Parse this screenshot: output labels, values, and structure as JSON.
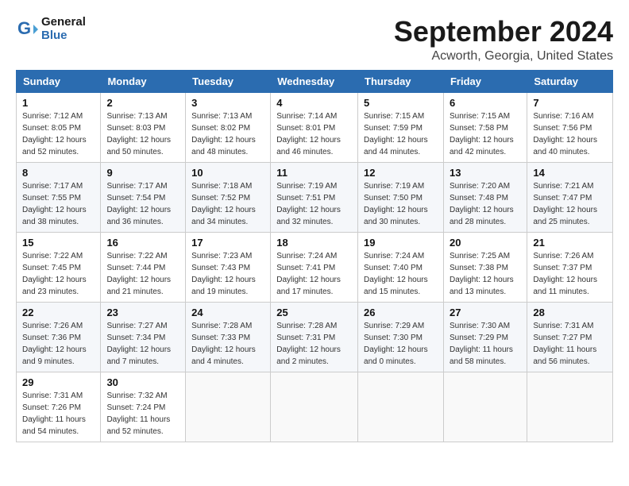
{
  "header": {
    "logo_line1": "General",
    "logo_line2": "Blue",
    "month": "September 2024",
    "location": "Acworth, Georgia, United States"
  },
  "days_of_week": [
    "Sunday",
    "Monday",
    "Tuesday",
    "Wednesday",
    "Thursday",
    "Friday",
    "Saturday"
  ],
  "weeks": [
    [
      {
        "day": "1",
        "info": "Sunrise: 7:12 AM\nSunset: 8:05 PM\nDaylight: 12 hours\nand 52 minutes."
      },
      {
        "day": "2",
        "info": "Sunrise: 7:13 AM\nSunset: 8:03 PM\nDaylight: 12 hours\nand 50 minutes."
      },
      {
        "day": "3",
        "info": "Sunrise: 7:13 AM\nSunset: 8:02 PM\nDaylight: 12 hours\nand 48 minutes."
      },
      {
        "day": "4",
        "info": "Sunrise: 7:14 AM\nSunset: 8:01 PM\nDaylight: 12 hours\nand 46 minutes."
      },
      {
        "day": "5",
        "info": "Sunrise: 7:15 AM\nSunset: 7:59 PM\nDaylight: 12 hours\nand 44 minutes."
      },
      {
        "day": "6",
        "info": "Sunrise: 7:15 AM\nSunset: 7:58 PM\nDaylight: 12 hours\nand 42 minutes."
      },
      {
        "day": "7",
        "info": "Sunrise: 7:16 AM\nSunset: 7:56 PM\nDaylight: 12 hours\nand 40 minutes."
      }
    ],
    [
      {
        "day": "8",
        "info": "Sunrise: 7:17 AM\nSunset: 7:55 PM\nDaylight: 12 hours\nand 38 minutes."
      },
      {
        "day": "9",
        "info": "Sunrise: 7:17 AM\nSunset: 7:54 PM\nDaylight: 12 hours\nand 36 minutes."
      },
      {
        "day": "10",
        "info": "Sunrise: 7:18 AM\nSunset: 7:52 PM\nDaylight: 12 hours\nand 34 minutes."
      },
      {
        "day": "11",
        "info": "Sunrise: 7:19 AM\nSunset: 7:51 PM\nDaylight: 12 hours\nand 32 minutes."
      },
      {
        "day": "12",
        "info": "Sunrise: 7:19 AM\nSunset: 7:50 PM\nDaylight: 12 hours\nand 30 minutes."
      },
      {
        "day": "13",
        "info": "Sunrise: 7:20 AM\nSunset: 7:48 PM\nDaylight: 12 hours\nand 28 minutes."
      },
      {
        "day": "14",
        "info": "Sunrise: 7:21 AM\nSunset: 7:47 PM\nDaylight: 12 hours\nand 25 minutes."
      }
    ],
    [
      {
        "day": "15",
        "info": "Sunrise: 7:22 AM\nSunset: 7:45 PM\nDaylight: 12 hours\nand 23 minutes."
      },
      {
        "day": "16",
        "info": "Sunrise: 7:22 AM\nSunset: 7:44 PM\nDaylight: 12 hours\nand 21 minutes."
      },
      {
        "day": "17",
        "info": "Sunrise: 7:23 AM\nSunset: 7:43 PM\nDaylight: 12 hours\nand 19 minutes."
      },
      {
        "day": "18",
        "info": "Sunrise: 7:24 AM\nSunset: 7:41 PM\nDaylight: 12 hours\nand 17 minutes."
      },
      {
        "day": "19",
        "info": "Sunrise: 7:24 AM\nSunset: 7:40 PM\nDaylight: 12 hours\nand 15 minutes."
      },
      {
        "day": "20",
        "info": "Sunrise: 7:25 AM\nSunset: 7:38 PM\nDaylight: 12 hours\nand 13 minutes."
      },
      {
        "day": "21",
        "info": "Sunrise: 7:26 AM\nSunset: 7:37 PM\nDaylight: 12 hours\nand 11 minutes."
      }
    ],
    [
      {
        "day": "22",
        "info": "Sunrise: 7:26 AM\nSunset: 7:36 PM\nDaylight: 12 hours\nand 9 minutes."
      },
      {
        "day": "23",
        "info": "Sunrise: 7:27 AM\nSunset: 7:34 PM\nDaylight: 12 hours\nand 7 minutes."
      },
      {
        "day": "24",
        "info": "Sunrise: 7:28 AM\nSunset: 7:33 PM\nDaylight: 12 hours\nand 4 minutes."
      },
      {
        "day": "25",
        "info": "Sunrise: 7:28 AM\nSunset: 7:31 PM\nDaylight: 12 hours\nand 2 minutes."
      },
      {
        "day": "26",
        "info": "Sunrise: 7:29 AM\nSunset: 7:30 PM\nDaylight: 12 hours\nand 0 minutes."
      },
      {
        "day": "27",
        "info": "Sunrise: 7:30 AM\nSunset: 7:29 PM\nDaylight: 11 hours\nand 58 minutes."
      },
      {
        "day": "28",
        "info": "Sunrise: 7:31 AM\nSunset: 7:27 PM\nDaylight: 11 hours\nand 56 minutes."
      }
    ],
    [
      {
        "day": "29",
        "info": "Sunrise: 7:31 AM\nSunset: 7:26 PM\nDaylight: 11 hours\nand 54 minutes."
      },
      {
        "day": "30",
        "info": "Sunrise: 7:32 AM\nSunset: 7:24 PM\nDaylight: 11 hours\nand 52 minutes."
      },
      {
        "day": "",
        "info": ""
      },
      {
        "day": "",
        "info": ""
      },
      {
        "day": "",
        "info": ""
      },
      {
        "day": "",
        "info": ""
      },
      {
        "day": "",
        "info": ""
      }
    ]
  ]
}
